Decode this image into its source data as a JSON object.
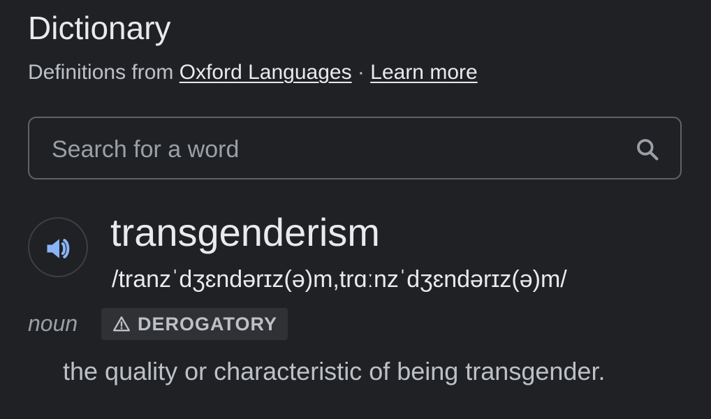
{
  "header": {
    "title": "Dictionary",
    "source_prefix": "Definitions from",
    "source_link": "Oxford Languages",
    "separator": " · ",
    "learn_more": "Learn more"
  },
  "search": {
    "placeholder": "Search for a word",
    "icon": "search-icon"
  },
  "entry": {
    "audio_icon": "speaker-icon",
    "word": "transgenderism",
    "phonetic": "/tranzˈdʒɛndərɪz(ə)m,trɑːnzˈdʒɛndərɪz(ə)m/",
    "part_of_speech": "noun",
    "label": {
      "icon": "warning-icon",
      "text": "DEROGATORY"
    },
    "definition": "the quality or characteristic of being transgender."
  },
  "colors": {
    "background": "#202124",
    "text_primary": "#e8eaed",
    "text_secondary": "#bdc1c6",
    "speaker_accent": "#8ab4f8"
  }
}
